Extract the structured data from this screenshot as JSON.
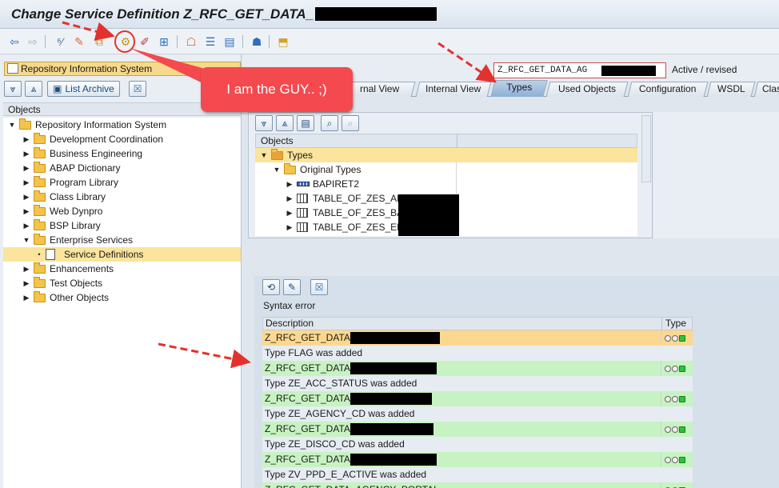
{
  "window": {
    "title": "Change Service Definition Z_RFC_GET_DATA_"
  },
  "toolbar": {
    "icons": [
      "back-icon",
      "forward-icon",
      "other-object-icon",
      "toggle-display-change-icon",
      "activate-icon",
      "check-icon",
      "test-icon",
      "where-used-icon",
      "object-list-icon",
      "navigation-window-icon",
      "display-object-list-icon",
      "help-icon",
      "local-objects-icon"
    ]
  },
  "left_pane": {
    "repository_box": "Repository Information System",
    "list_archive": "List Archive",
    "objects_header": "Objects",
    "tree": [
      {
        "label": "Repository Information System",
        "level": 0,
        "expanded": true
      },
      {
        "label": "Development Coordination",
        "level": 1,
        "expanded": false
      },
      {
        "label": "Business Engineering",
        "level": 1,
        "expanded": false
      },
      {
        "label": "ABAP Dictionary",
        "level": 1,
        "expanded": false
      },
      {
        "label": "Program Library",
        "level": 1,
        "expanded": false
      },
      {
        "label": "Class Library",
        "level": 1,
        "expanded": false
      },
      {
        "label": "Web Dynpro",
        "level": 1,
        "expanded": false
      },
      {
        "label": "BSP Library",
        "level": 1,
        "expanded": false
      },
      {
        "label": "Enterprise Services",
        "level": 1,
        "expanded": true
      },
      {
        "label": "Service Definitions",
        "level": 2,
        "selected": true
      },
      {
        "label": "Enhancements",
        "level": 1,
        "expanded": false
      },
      {
        "label": "Test Objects",
        "level": 1,
        "expanded": false
      },
      {
        "label": "Other Objects",
        "level": 1,
        "expanded": false
      }
    ]
  },
  "header": {
    "object_name": "Z_RFC_GET_DATA_AG",
    "status": "Active / revised"
  },
  "tabs": [
    {
      "label": "rnal View"
    },
    {
      "label": "Internal View"
    },
    {
      "label": "Types",
      "active": true
    },
    {
      "label": "Used Objects"
    },
    {
      "label": "Configuration"
    },
    {
      "label": "WSDL"
    },
    {
      "label": "Clas"
    }
  ],
  "types_panel": {
    "column_header": "Objects",
    "rows": [
      {
        "label": "Types",
        "level": 0
      },
      {
        "label": "Original Types",
        "level": 1
      },
      {
        "label": "BAPIRET2",
        "level": 2
      },
      {
        "label": "TABLE_OF_ZES_AP",
        "level": 2
      },
      {
        "label": "TABLE_OF_ZES_BA",
        "level": 2
      },
      {
        "label": "TABLE_OF_ZES_ERI",
        "level": 2
      }
    ]
  },
  "messages": {
    "title": "Syntax error",
    "col_description": "Description",
    "col_type": "Type",
    "rows": [
      {
        "text": "Z_RFC_GET_DATA_A",
        "style": "yellow"
      },
      {
        "text": "Type FLAG was added",
        "style": "white"
      },
      {
        "text": "Z_RFC_GET_DATA_",
        "style": "green"
      },
      {
        "text": "Type ZE_ACC_STATUS was added",
        "style": "white"
      },
      {
        "text": "Z_RFC_GET_DATA_",
        "style": "green"
      },
      {
        "text": "Type ZE_AGENCY_CD was added",
        "style": "white"
      },
      {
        "text": "Z_RFC_GET_DATA_A",
        "style": "green"
      },
      {
        "text": "Type ZE_DISCO_CD was added",
        "style": "white"
      },
      {
        "text": "Z_RFC_GET_DATA_",
        "style": "green"
      },
      {
        "text": "Type ZV_PPD_E_ACTIVE was added",
        "style": "white"
      },
      {
        "text": "Z_RFC_GET_DATA_AGENCY_PORTAL",
        "style": "green"
      }
    ]
  },
  "annotation": {
    "callout_text": "I am the GUY.. ;)",
    "color": "#f4494e"
  }
}
